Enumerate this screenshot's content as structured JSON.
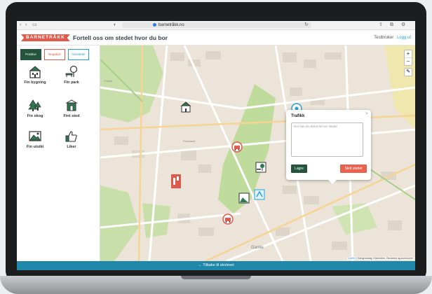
{
  "browser": {
    "url": "barnetråkk.no",
    "nav_icons": [
      "back-icon",
      "forward-icon",
      "sidebar-icon"
    ],
    "action_icons": [
      "reload-icon",
      "share-icon",
      "tabs-icon",
      "settings-icon"
    ]
  },
  "header": {
    "logo": "BARNETRÅKK",
    "title": "Fortell oss om stedet hvor du bor",
    "user": "Testbruker",
    "logout": "Logg ut"
  },
  "sidebar": {
    "tabs": [
      {
        "label": "Positive",
        "active": true
      },
      {
        "label": "Negative",
        "active": false
      },
      {
        "label": "Aktiviteter",
        "active": false
      }
    ],
    "categories": [
      {
        "label": "Fin bygning",
        "icon": "building-icon"
      },
      {
        "label": "Fin park",
        "icon": "park-icon"
      },
      {
        "label": "Fin skog",
        "icon": "forest-icon"
      },
      {
        "label": "Fint sted",
        "icon": "nice-place-icon"
      },
      {
        "label": "Fin utsikt",
        "icon": "view-icon"
      },
      {
        "label": "Liker",
        "icon": "thumbs-up-icon"
      }
    ]
  },
  "map": {
    "labels": [
      "Festpl.",
      "Finnsland",
      "Gamle"
    ],
    "zoom_in": "+",
    "zoom_out": "−",
    "attribution_leaflet": "Leaflet",
    "attribution_text": "| Kartgrunnlag: Kartverket, Geovekst og kommuner",
    "markers": [
      "building-marker",
      "soccer-marker",
      "traffic-marker",
      "traffic-marker",
      "traffic-marker",
      "park-marker",
      "view-marker",
      "activity-marker",
      "flag-marker"
    ]
  },
  "popup": {
    "title": "Trafikk",
    "close": "×",
    "placeholder": "Her kan du skrive litt om stedet",
    "save": "Lagre",
    "delete": "Slett stedet"
  },
  "footer": {
    "back": "← Tilbake til skolevei"
  },
  "colors": {
    "accent_green": "#24553c",
    "accent_red": "#e05a4b",
    "footer_blue": "#1f87a8"
  }
}
